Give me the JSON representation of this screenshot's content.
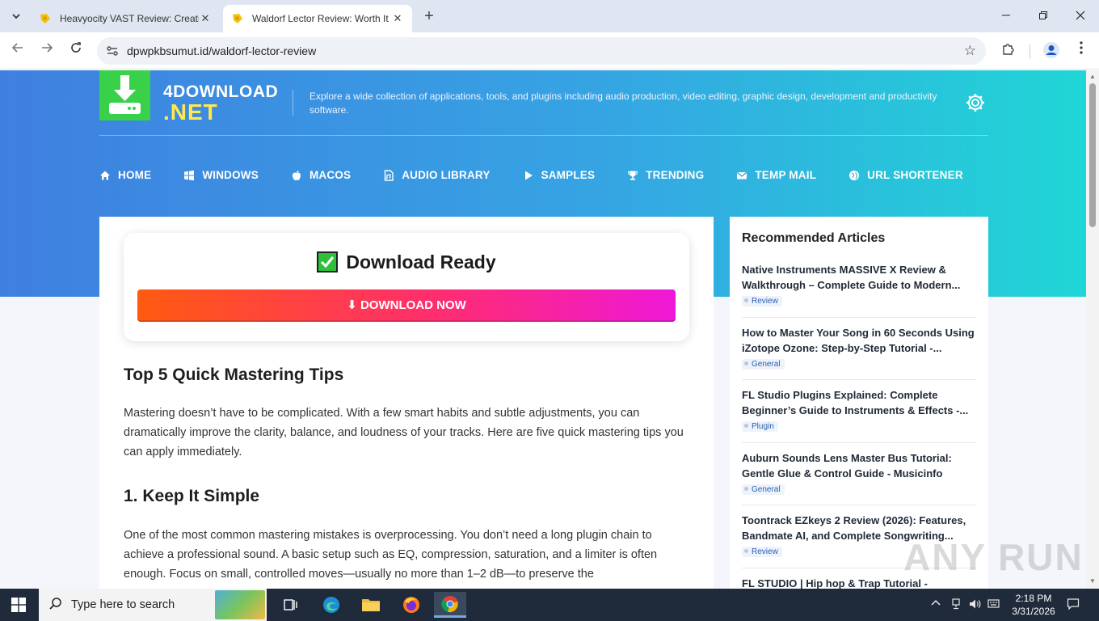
{
  "browser": {
    "tabs": [
      {
        "title": "Heavyocity VAST Review: Creati",
        "active": false
      },
      {
        "title": "Waldorf Lector Review: Worth It",
        "active": true
      }
    ],
    "url": "dpwpkbsumut.id/waldorf-lector-review"
  },
  "site": {
    "brand_line1": "4DOWNLOAD",
    "brand_line2": ".NET",
    "tagline": "Explore a wide collection of applications, tools, and plugins including audio production, video editing, graphic design, development and productivity software.",
    "menu": [
      {
        "label": "HOME",
        "icon": "home-icon"
      },
      {
        "label": "WINDOWS",
        "icon": "windows-icon"
      },
      {
        "label": "MACOS",
        "icon": "apple-icon"
      },
      {
        "label": "AUDIO LIBRARY",
        "icon": "audio-file-icon"
      },
      {
        "label": "SAMPLES",
        "icon": "play-icon"
      },
      {
        "label": "TRENDING",
        "icon": "trophy-icon"
      },
      {
        "label": "TEMP MAIL",
        "icon": "envelope-icon"
      },
      {
        "label": "URL SHORTENER",
        "icon": "globe-icon"
      }
    ]
  },
  "download": {
    "title": "Download Ready",
    "button": "⬇ DOWNLOAD NOW"
  },
  "article": {
    "h2_tips": "Top 5 Quick Mastering Tips",
    "intro": "Mastering doesn’t have to be complicated. With a few smart habits and subtle adjustments, you can dramatically improve the clarity, balance, and loudness of your tracks. Here are five quick mastering tips you can apply immediately.",
    "h2_simple": "1. Keep It Simple",
    "simple_p": "One of the most common mastering mistakes is overprocessing. You don’t need a long plugin chain to achieve a professional sound. A basic setup such as EQ, compression, saturation, and a limiter is often enough. Focus on small, controlled moves—usually no more than 1–2 dB—to preserve the"
  },
  "sidebar": {
    "title": "Recommended Articles",
    "items": [
      {
        "title": "Native Instruments MASSIVE X Review & Walkthrough – Complete Guide to Modern...",
        "tag": "Review"
      },
      {
        "title": "How to Master Your Song in 60 Seconds Using iZotope Ozone: Step-by-Step Tutorial -...",
        "tag": "General"
      },
      {
        "title": "FL Studio Plugins Explained: Complete Beginner’s Guide to Instruments & Effects -...",
        "tag": "Plugin"
      },
      {
        "title": "Auburn Sounds Lens Master Bus Tutorial: Gentle Glue & Control Guide - Musicinfo",
        "tag": "General"
      },
      {
        "title": "Toontrack EZkeys 2 Review (2026): Features, Bandmate AI, and Complete Songwriting...",
        "tag": "Review"
      },
      {
        "title": "FL STUDIO | Hip hop & Trap Tutorial -",
        "tag": ""
      }
    ]
  },
  "watermark": "ANY RUN",
  "taskbar": {
    "search_placeholder": "Type here to search",
    "time": "2:18 PM",
    "date": "3/31/2026"
  },
  "colors": {
    "hero_start": "#3f7fe0",
    "hero_end": "#20d6d6",
    "brand_yellow": "#ffe94d",
    "logo_green": "#39d14a",
    "download_start": "#ff5a10",
    "download_end": "#ee18d8"
  }
}
